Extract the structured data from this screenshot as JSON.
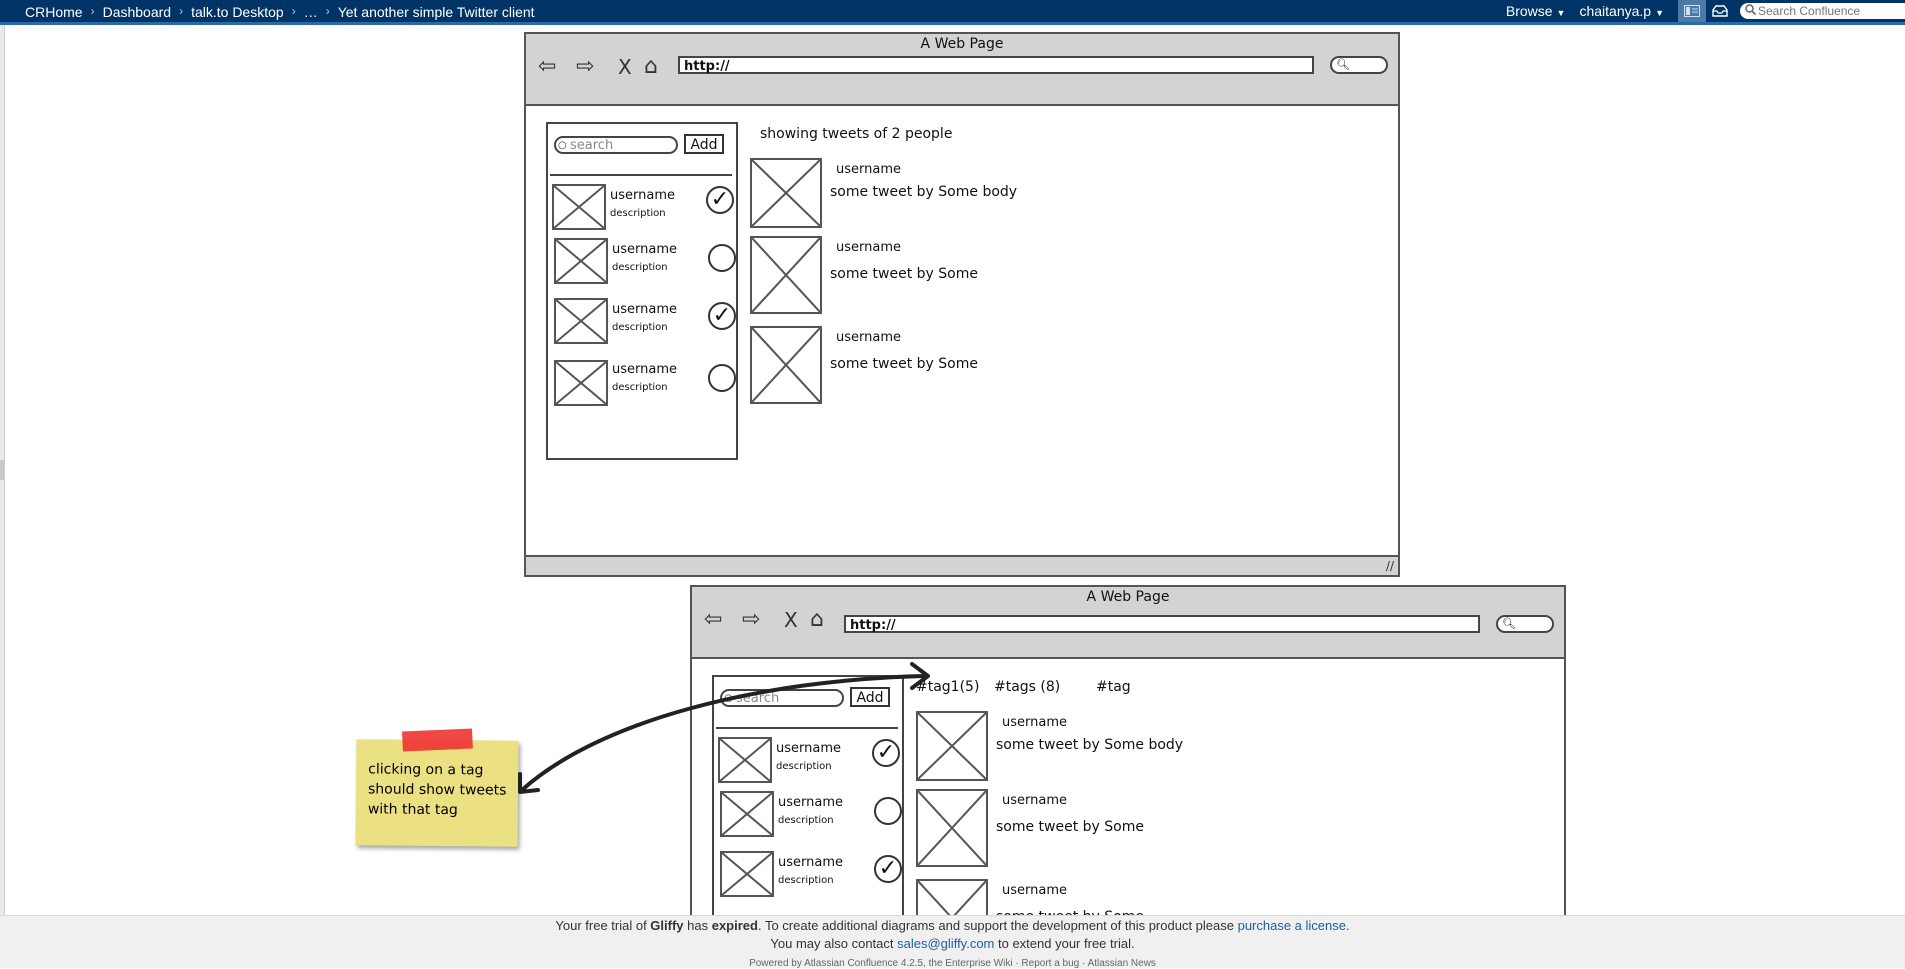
{
  "nav": {
    "crumbs": [
      "CRHome",
      "Dashboard",
      "talk.to Desktop",
      "…",
      "Yet another simple Twitter client"
    ],
    "separator": "›",
    "browse": "Browse",
    "user": "chaitanya.p",
    "search_placeholder": "Search Confluence"
  },
  "mockup_top": {
    "title": "A Web Page",
    "url": "http://",
    "search_placeholder": "search",
    "add_label": "Add",
    "heading": "showing tweets of 2 people",
    "users": [
      {
        "name": "username",
        "desc": "description",
        "checked": true
      },
      {
        "name": "username",
        "desc": "description",
        "checked": false
      },
      {
        "name": "username",
        "desc": "description",
        "checked": true
      },
      {
        "name": "username",
        "desc": "description",
        "checked": false
      }
    ],
    "tweets": [
      {
        "user": "username",
        "text": "some tweet by  Some body"
      },
      {
        "user": "username",
        "text": "some tweet by  Some"
      },
      {
        "user": "username",
        "text": "some tweet by  Some"
      }
    ]
  },
  "mockup_bottom": {
    "title": "A Web Page",
    "url": "http://",
    "search_placeholder": "search",
    "add_label": "Add",
    "tags": [
      "#tag1(5)",
      "#tags (8)",
      "#tag"
    ],
    "users": [
      {
        "name": "username",
        "desc": "description",
        "checked": true
      },
      {
        "name": "username",
        "desc": "description",
        "checked": false
      },
      {
        "name": "username",
        "desc": "description",
        "checked": true
      }
    ],
    "tweets": [
      {
        "user": "username",
        "text": "some tweet by  Some body"
      },
      {
        "user": "username",
        "text": "some tweet by  Some"
      },
      {
        "user": "username",
        "text": "some tweet by  Some"
      }
    ]
  },
  "note": {
    "text": "clicking on a tag should show tweets with that tag"
  },
  "footer": {
    "line1_a": "Your free trial of ",
    "line1_gliffy": "Gliffy",
    "line1_b": " has ",
    "line1_expired": "expired",
    "line1_c": ". To create additional diagrams and support the development of this product please ",
    "line1_link": "purchase a license.",
    "line2_a": "You may also contact ",
    "line2_link": "sales@gliffy.com",
    "line2_b": " to extend your free trial.",
    "line3": "Powered by Atlassian Confluence 4.2.5, the Enterprise Wiki  ·  Report a bug  ·  Atlassian News"
  },
  "colors": {
    "nav_bg": "#003366",
    "link": "#1b5fa8",
    "note_bg": "#ebe082",
    "tape": "#e33333"
  }
}
